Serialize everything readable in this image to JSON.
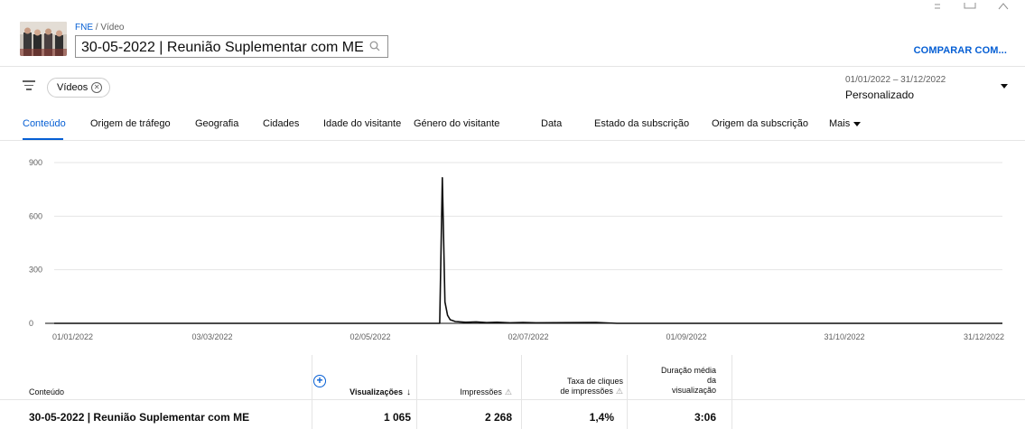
{
  "header": {
    "breadcrumb_channel": "FNE",
    "breadcrumb_sep": "/",
    "breadcrumb_page": "Vídeo",
    "title": "30-05-2022 | Reunião Suplementar com ME",
    "compare_label": "COMPARAR COM..."
  },
  "filters": {
    "chip_label": "Vídeos"
  },
  "date_picker": {
    "range": "01/01/2022 – 31/12/2022",
    "preset": "Personalizado"
  },
  "tabs": [
    {
      "label": "Conteúdo"
    },
    {
      "label": "Origem de tráfego"
    },
    {
      "label": "Geografia"
    },
    {
      "label": "Cidades"
    },
    {
      "label": "Idade do visitante"
    },
    {
      "label": "Género do visitante"
    },
    {
      "label": "Data"
    },
    {
      "label": "Estado da subscrição"
    },
    {
      "label": "Origem da subscrição"
    },
    {
      "label": "Mais"
    }
  ],
  "chart_data": {
    "type": "line",
    "x_ticks": [
      "01/01/2022",
      "03/03/2022",
      "02/05/2022",
      "02/07/2022",
      "01/09/2022",
      "31/10/2022",
      "31/12/2022"
    ],
    "y_ticks": [
      0,
      300,
      600,
      900
    ],
    "ylim": [
      0,
      900
    ],
    "xlim": [
      "2022-01-01",
      "2022-12-31"
    ],
    "grid": true,
    "series": [
      {
        "color": "#0d0d0d",
        "points": [
          [
            "2022-01-01",
            0
          ],
          [
            "2022-05-29",
            0
          ],
          [
            "2022-05-30",
            815
          ],
          [
            "2022-05-31",
            120
          ],
          [
            "2022-06-01",
            45
          ],
          [
            "2022-06-02",
            20
          ],
          [
            "2022-06-04",
            10
          ],
          [
            "2022-06-08",
            6
          ],
          [
            "2022-06-12",
            8
          ],
          [
            "2022-06-16",
            4
          ],
          [
            "2022-06-20",
            6
          ],
          [
            "2022-06-25",
            3
          ],
          [
            "2022-06-30",
            5
          ],
          [
            "2022-07-05",
            3
          ],
          [
            "2022-07-20",
            4
          ],
          [
            "2022-07-28",
            5
          ],
          [
            "2022-08-05",
            0
          ],
          [
            "2022-12-31",
            0
          ]
        ]
      }
    ]
  },
  "table": {
    "headers": {
      "content": "Conteúdo",
      "views": "Visualizações",
      "impressions": "Impressões",
      "ctr_line1": "Taxa de cliques",
      "ctr_line2": "de impressões",
      "duration_line1": "Duração média",
      "duration_line2": "da",
      "duration_line3": "visualização"
    },
    "rows": [
      {
        "content": "30-05-2022 | Reunião Suplementar com ME",
        "views": "1 065",
        "impressions": "2 268",
        "ctr": "1,4%",
        "duration": "3:06"
      }
    ]
  }
}
